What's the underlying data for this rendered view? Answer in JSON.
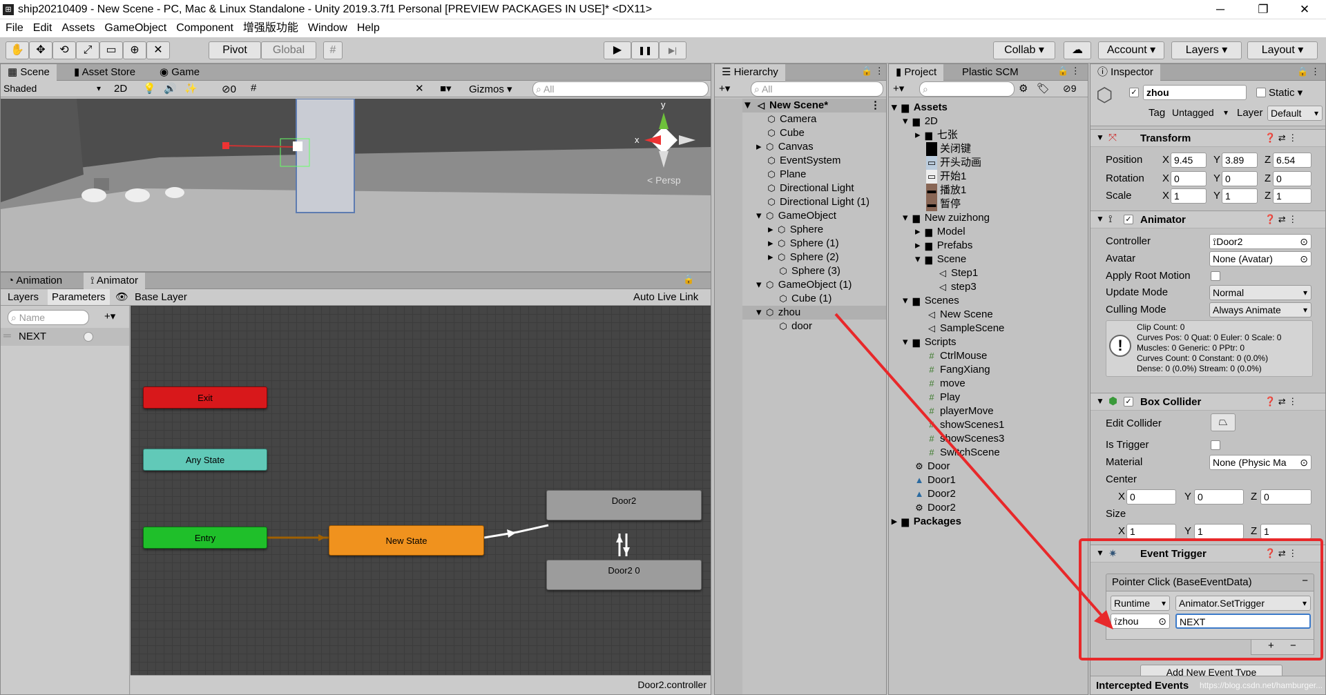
{
  "window": {
    "title": "ship20210409 - New Scene - PC, Mac & Linux Standalone - Unity 2019.3.7f1 Personal [PREVIEW PACKAGES IN USE]* <DX11>",
    "logo": "⊞",
    "min": "─",
    "max": "❐",
    "close": "✕"
  },
  "menu": [
    "File",
    "Edit",
    "Assets",
    "GameObject",
    "Component",
    "增强版功能",
    "Window",
    "Help"
  ],
  "toolbar": {
    "pivot": "Pivot",
    "global": "Global",
    "collab": "Collab",
    "account": "Account",
    "layers": "Layers",
    "layout": "Layout",
    "play": "▶",
    "pause": "❚❚",
    "step": "▶|"
  },
  "scene_panel": {
    "tabs": [
      "Scene",
      "Asset Store",
      "Game"
    ],
    "shaded": "Shaded",
    "mode2d": "2D",
    "vis_count": "0",
    "gizmos": "Gizmos",
    "search_placeholder": "All",
    "persp": "< Persp",
    "axis_x": "x",
    "axis_y": "y"
  },
  "animator_panel": {
    "tabs": [
      "Animation",
      "Animator"
    ],
    "subtabs": [
      "Layers",
      "Parameters"
    ],
    "layer": "Base Layer",
    "live_link": "Auto Live Link",
    "name_placeholder": "Name",
    "param": "NEXT",
    "footer": "Door2.controller",
    "nodes": {
      "exit": "Exit",
      "any": "Any State",
      "entry": "Entry",
      "newstate": "New State",
      "door2": "Door2",
      "door20": "Door2 0"
    }
  },
  "hierarchy": {
    "tab": "Hierarchy",
    "search_placeholder": "All",
    "scene": "New Scene*",
    "items": [
      "Camera",
      "Cube",
      "Canvas",
      "EventSystem",
      "Plane",
      "Directional Light",
      "Directional Light (1)",
      "GameObject",
      "Sphere",
      "Sphere (1)",
      "Sphere (2)",
      "Sphere (3)",
      "GameObject (1)",
      "Cube (1)",
      "zhou",
      "door"
    ]
  },
  "project": {
    "tabs": [
      "Project",
      "Plastic SCM"
    ],
    "hidden_count": "9",
    "items": [
      "Assets",
      "2D",
      "七张",
      "关闭键",
      "开头动画",
      "开始1",
      "播放1",
      "暂停",
      "New zuizhong",
      "Model",
      "Prefabs",
      "Scene",
      "Step1",
      "step3",
      "Scenes",
      "New Scene",
      "SampleScene",
      "Scripts",
      "CtrlMouse",
      "FangXiang",
      "move",
      "Play",
      "playerMove",
      "showScenes1",
      "showScenes3",
      "SwitchScene",
      "Door",
      "Door1",
      "Door2",
      "Door2",
      "Packages"
    ]
  },
  "inspector": {
    "tab": "Inspector",
    "name": "zhou",
    "static": "Static",
    "tag_label": "Tag",
    "tag": "Untagged",
    "layer_label": "Layer",
    "layer": "Default",
    "transform": {
      "title": "Transform",
      "position": "Position",
      "rotation": "Rotation",
      "scale": "Scale",
      "pos": [
        "9.45",
        "3.89",
        "6.54"
      ],
      "rot": [
        "0",
        "0",
        "0"
      ],
      "scl": [
        "1",
        "1",
        "1"
      ]
    },
    "animator": {
      "title": "Animator",
      "controller_label": "Controller",
      "controller": "Door2",
      "avatar_label": "Avatar",
      "avatar": "None (Avatar)",
      "root_motion": "Apply Root Motion",
      "update_label": "Update Mode",
      "update": "Normal",
      "culling_label": "Culling Mode",
      "culling": "Always Animate",
      "info": [
        "Clip Count: 0",
        "Curves Pos: 0 Quat: 0 Euler: 0 Scale: 0",
        "Muscles: 0 Generic: 0 PPtr: 0",
        "Curves Count: 0 Constant: 0 (0.0%)",
        "Dense: 0 (0.0%) Stream: 0 (0.0%)"
      ]
    },
    "box": {
      "title": "Box Collider",
      "edit": "Edit Collider",
      "trigger": "Is Trigger",
      "material_label": "Material",
      "material": "None (Physic Ma",
      "center": "Center",
      "size": "Size",
      "c": [
        "0",
        "0",
        "0"
      ],
      "s": [
        "1",
        "1",
        "1"
      ]
    },
    "event": {
      "title": "Event Trigger",
      "entry": "Pointer Click (BaseEventData)",
      "runtime": "Runtime",
      "func": "Animator.SetTrigger",
      "obj": "zhou",
      "arg": "NEXT",
      "add": "Add New Event Type",
      "plus": "+",
      "minus": "−"
    },
    "intercepted": "Intercepted Events",
    "watermark": "https://blog.csdn.net/hamburger..."
  },
  "axes": [
    "X",
    "Y",
    "Z"
  ]
}
